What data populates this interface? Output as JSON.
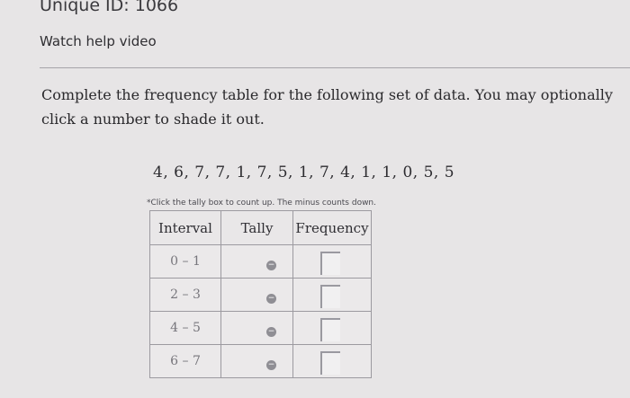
{
  "header": {
    "unique_id": "Unique ID: 1066",
    "help_link": "Watch help video"
  },
  "instructions": "Complete the frequency table for the following set of data. You may optionally click a number to shade it out.",
  "dataset": "4, 6, 7, 7, 1, 7, 5, 1, 7, 4, 1, 1, 0, 5, 5",
  "hint": "*Click the tally box to count up. The minus counts down.",
  "table": {
    "headers": [
      "Interval",
      "Tally",
      "Frequency"
    ],
    "rows": [
      {
        "interval": "0 – 1"
      },
      {
        "interval": "2 – 3"
      },
      {
        "interval": "4 – 5"
      },
      {
        "interval": "6 – 7"
      }
    ],
    "minus_symbol": "−"
  }
}
